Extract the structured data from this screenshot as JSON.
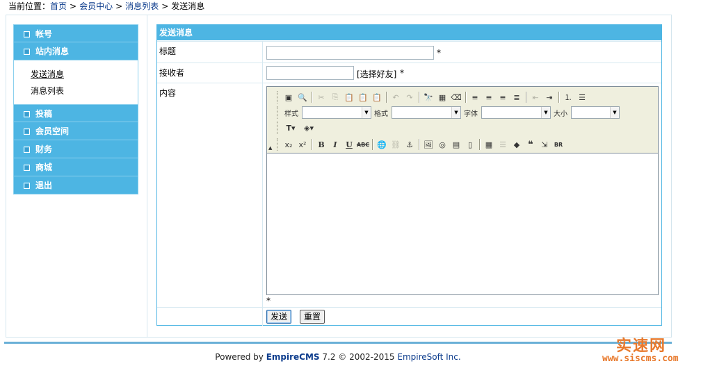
{
  "breadcrumb": {
    "prefix": "当前位置：",
    "items": [
      "首页",
      "会员中心",
      "消息列表",
      "发送消息"
    ],
    "separator": ">"
  },
  "sidebar": {
    "items": [
      {
        "label": "帐号"
      },
      {
        "label": "站内消息"
      },
      {
        "label": "投稿"
      },
      {
        "label": "会员空间"
      },
      {
        "label": "财务"
      },
      {
        "label": "商城"
      },
      {
        "label": "退出"
      }
    ],
    "sub_items": [
      {
        "label": "发送消息"
      },
      {
        "label": "消息列表"
      }
    ]
  },
  "form": {
    "title": "发送消息",
    "subject_label": "标题",
    "subject_value": "",
    "receiver_label": "接收者",
    "receiver_value": "",
    "choose_friend": "[选择好友]",
    "content_label": "内容",
    "required_mark": "*",
    "submit_label": "发送",
    "reset_label": "重置"
  },
  "editor": {
    "style_label": "样式",
    "format_label": "格式",
    "font_label": "字体",
    "size_label": "大小",
    "style_value": "",
    "format_value": "",
    "font_value": "",
    "size_value": ""
  },
  "footer": {
    "powered": "Powered by",
    "product": "EmpireCMS",
    "version": "7.2",
    "copyright": "© 2002-2015",
    "company": "EmpireSoft Inc."
  },
  "watermark": {
    "title": "实速网",
    "url": "www.siscms.com"
  },
  "colors": {
    "accent": "#4db5e3",
    "toolbar_bg": "#efefde",
    "watermark": "#e8792c"
  }
}
